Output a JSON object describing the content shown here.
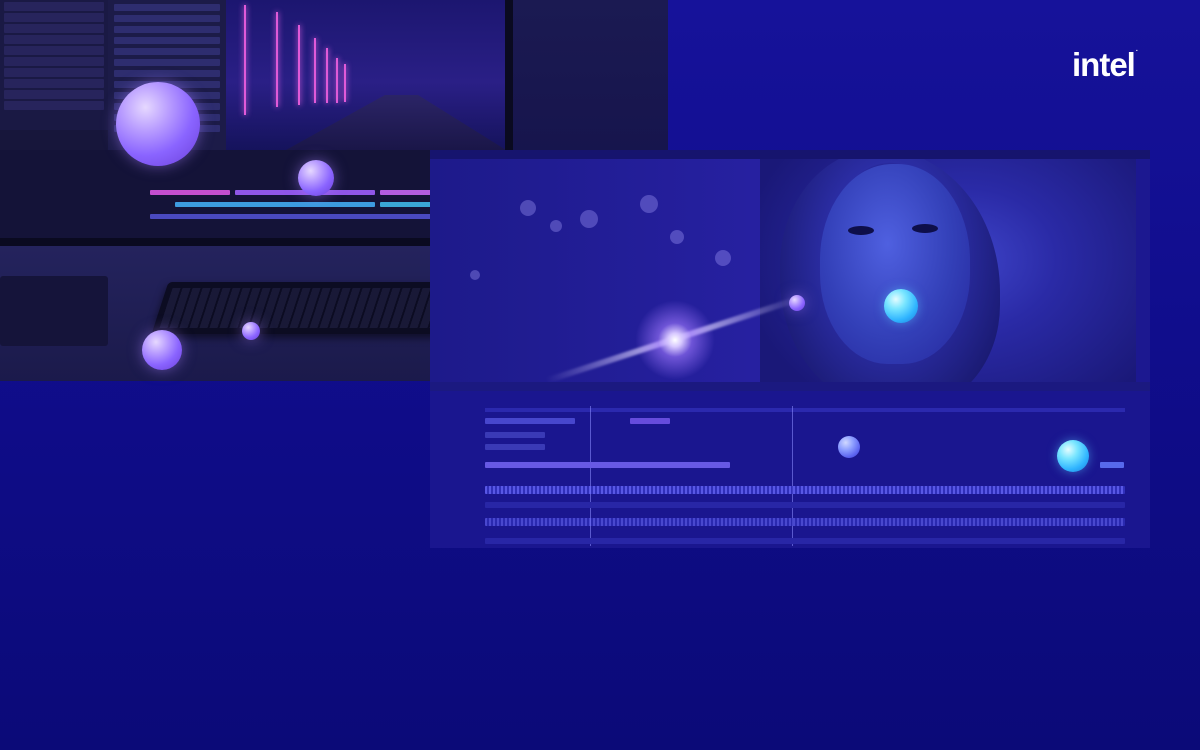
{
  "brand": {
    "logo_text": "intel",
    "logo_mark": ".",
    "colors": {
      "background": "#100d8c",
      "logo": "#ffffff",
      "accent_purple": "#8a64ff",
      "accent_cyan": "#2fb4ff"
    }
  },
  "images": {
    "left_panel": "video-editing-monitor-photo",
    "right_panel": "portrait-with-lens-flare",
    "editor_panel": "video-timeline-editor"
  }
}
